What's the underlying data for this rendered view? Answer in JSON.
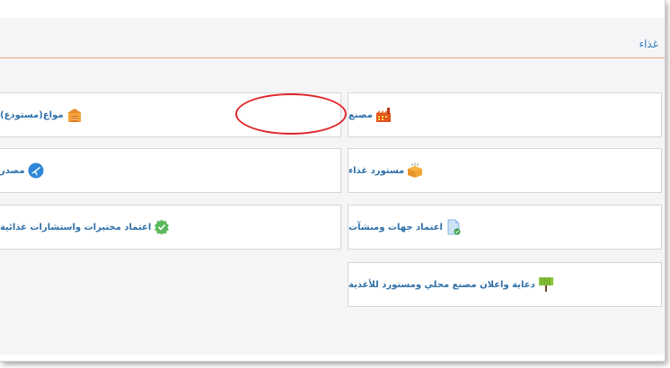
{
  "section": {
    "title": "غذاء"
  },
  "cards": {
    "factory": {
      "label": "مصنع",
      "icon": "factory-icon"
    },
    "warehouse": {
      "label": "مواع(مستودع)",
      "icon": "warehouse-icon"
    },
    "food_importer": {
      "label": "مستورد غذاء",
      "icon": "box-icon"
    },
    "exporter": {
      "label": "مصدر",
      "icon": "airplane-icon"
    },
    "entity_approval": {
      "label": "اعتماد جهات ومنشآت",
      "icon": "document-check-icon"
    },
    "lab_approval": {
      "label": "اعتماد مختبرات واستشارات غذائية",
      "icon": "verified-badge-icon"
    },
    "advertising": {
      "label": "دعاية واعلان مصنع محلي ومستورد للأغذية",
      "icon": "billboard-icon"
    }
  },
  "colors": {
    "accent": "#2e7fc1",
    "rule": "#e8a27a",
    "highlight": "#e0262a"
  }
}
